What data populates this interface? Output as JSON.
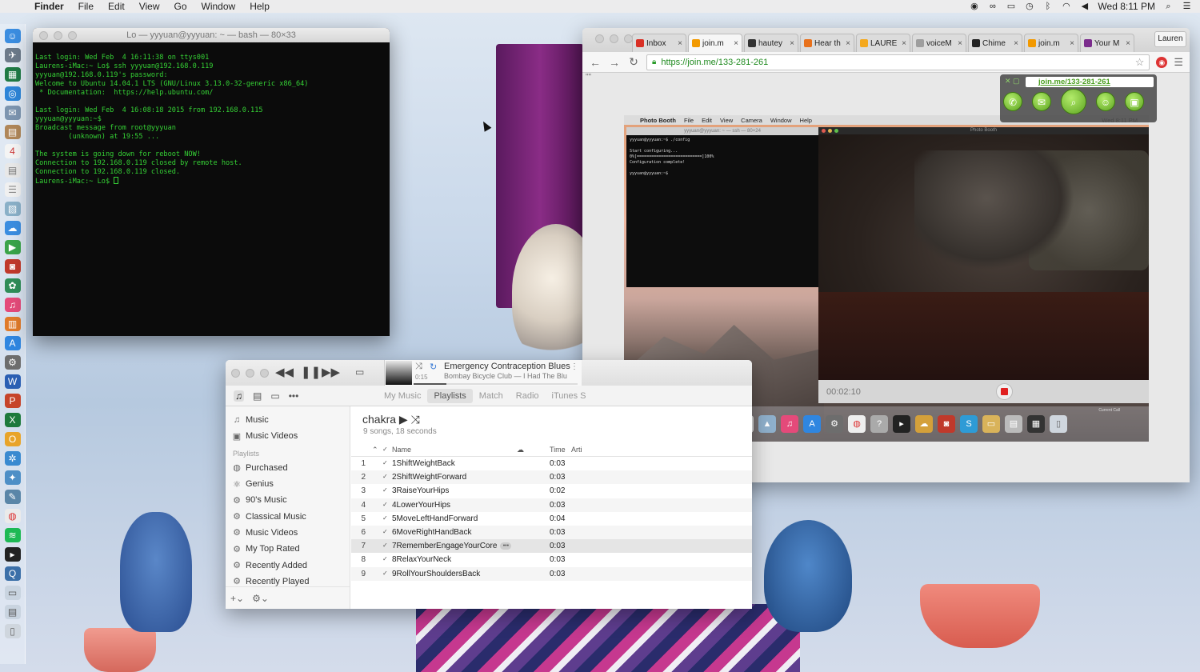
{
  "menubar": {
    "app": "Finder",
    "items": [
      "File",
      "Edit",
      "View",
      "Go",
      "Window",
      "Help"
    ],
    "clock": "Wed 8:11 PM"
  },
  "terminal": {
    "title": "Lo — yyyuan@yyyuan: ~ — bash — 80×33",
    "lines": [
      "Last login: Wed Feb  4 16:11:38 on ttys001",
      "Laurens-iMac:~ Lo$ ssh yyyuan@192.168.0.119",
      "yyyuan@192.168.0.119's password:",
      "Welcome to Ubuntu 14.04.1 LTS (GNU/Linux 3.13.0-32-generic x86_64)",
      "",
      " * Documentation:  https://help.ubuntu.com/",
      "",
      "Last login: Wed Feb  4 16:08:18 2015 from 192.168.0.115",
      "yyyuan@yyyuan:~$",
      "Broadcast message from root@yyyuan",
      "        (unknown) at 19:55 ...",
      "",
      "The system is going down for reboot NOW!",
      "Connection to 192.168.0.119 closed by remote host.",
      "Connection to 192.168.0.119 closed.",
      "Laurens-iMac:~ Lo$ "
    ]
  },
  "browser": {
    "tabs": [
      {
        "label": "Inbox",
        "color": "#d93025"
      },
      {
        "label": "join.m",
        "color": "#f29900"
      },
      {
        "label": "hautey",
        "color": "#333333"
      },
      {
        "label": "Hear th",
        "color": "#e8711c"
      },
      {
        "label": "LAURE",
        "color": "#f4a81d"
      },
      {
        "label": "voiceM",
        "color": "#9e9e9e"
      },
      {
        "label": "Chime",
        "color": "#222222"
      },
      {
        "label": "join.m",
        "color": "#f29900"
      },
      {
        "label": "Your M",
        "color": "#7b2c8c"
      }
    ],
    "profile": "Lauren",
    "url": "https://join.me/133-281-261",
    "page_dots": "\"\"",
    "joinme_url": "join.me/133-281-261"
  },
  "shared_screen": {
    "menubar": [
      "Photo Booth",
      "File",
      "Edit",
      "View",
      "Camera",
      "Window",
      "Help"
    ],
    "menubar_right": "Wed 8:11 PM",
    "term_title": "yyyuan@yyyuan: ~ — ssh — 80×24",
    "term_lines": [
      "yyyuan@yyyuan:~$ ./config",
      "",
      "Start configuring...",
      "0%[===========================]100%",
      "Configuration complete!",
      "",
      "yyyuan@yyyuan:~$ "
    ],
    "photobooth_title": "Photo Booth",
    "timer": "00:02:10",
    "current_call": "Current Call"
  },
  "itunes": {
    "now_playing": {
      "song": "Emergency Contraception Blues",
      "artist": "Bombay Bicycle Club — I Had The Blu",
      "elapsed": "0:15",
      "progress": 0.2
    },
    "views": [
      "My Music",
      "Playlists",
      "Match",
      "Radio",
      "iTunes S"
    ],
    "active_view": "Playlists",
    "sidebar": {
      "library": [
        "Music",
        "Music Videos"
      ],
      "playlists_header": "Playlists",
      "playlists": [
        "Purchased",
        "Genius",
        "90's Music",
        "Classical Music",
        "Music Videos",
        "My Top Rated",
        "Recently Added",
        "Recently Played"
      ]
    },
    "playlist": {
      "name": "chakra",
      "meta": "9 songs, 18 seconds"
    },
    "columns": {
      "check": "✓",
      "name": "Name",
      "time": "Time",
      "artist": "Arti"
    },
    "tracks": [
      {
        "num": "1",
        "name": "1ShiftWeightBack",
        "time": "0:03"
      },
      {
        "num": "2",
        "name": "2ShiftWeightForward",
        "time": "0:03"
      },
      {
        "num": "3",
        "name": "3RaiseYourHips",
        "time": "0:02"
      },
      {
        "num": "4",
        "name": "4LowerYourHips",
        "time": "0:03"
      },
      {
        "num": "5",
        "name": "5MoveLeftHandForward",
        "time": "0:04"
      },
      {
        "num": "6",
        "name": "6MoveRightHandBack",
        "time": "0:03"
      },
      {
        "num": "7",
        "name": "7RememberEngageYourCore",
        "time": "0:03"
      },
      {
        "num": "8",
        "name": "8RelaxYourNeck",
        "time": "0:03"
      },
      {
        "num": "9",
        "name": "9RollYourShouldersBack",
        "time": "0:03"
      }
    ],
    "selected_track": 7
  }
}
